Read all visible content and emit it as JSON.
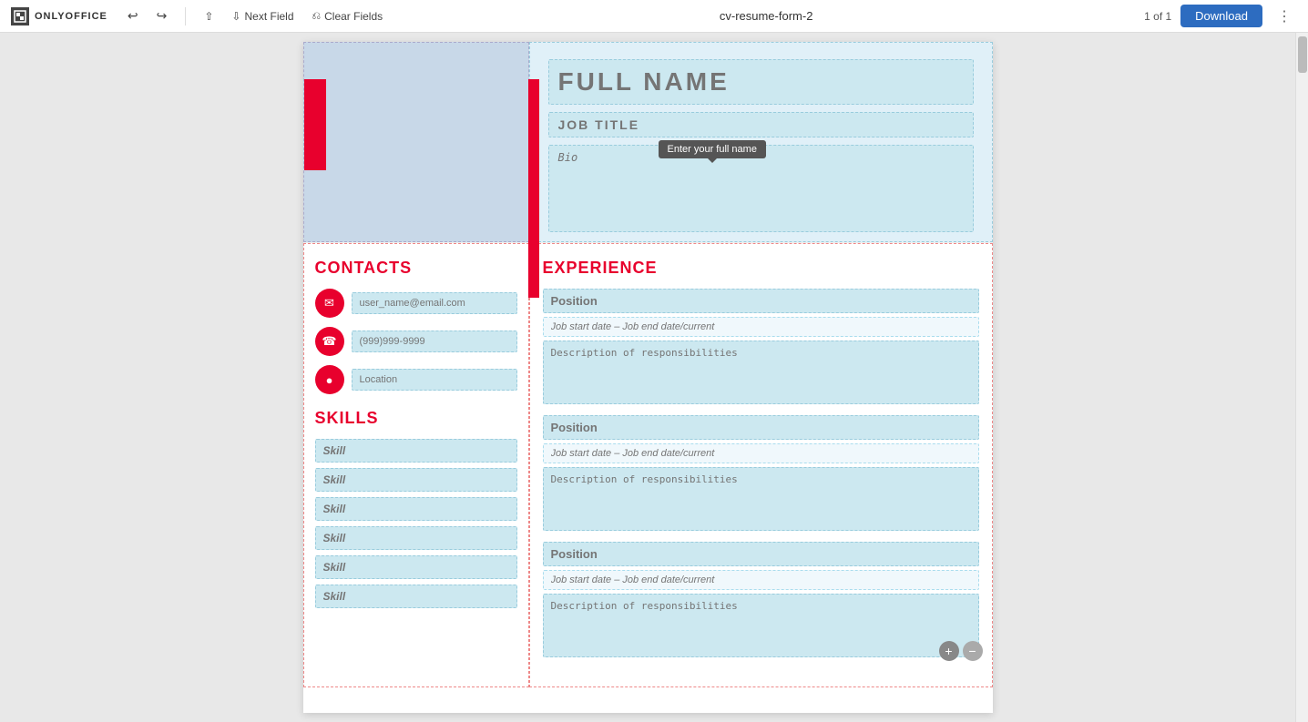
{
  "toolbar": {
    "logo_text": "ONLYOFFICE",
    "undo_label": "↩",
    "redo_label": "↪",
    "next_field_label": "Next Field",
    "clear_fields_label": "Clear Fields",
    "document_name": "cv-resume-form-2",
    "page_count": "1 of 1",
    "download_label": "Download",
    "more_label": "⋮"
  },
  "tooltip": {
    "text": "Enter your full name"
  },
  "resume": {
    "full_name_placeholder": "FULL NAME",
    "job_title_placeholder": "JOB TITLE",
    "bio_placeholder": "Bio",
    "contacts_title": "CONTACTS",
    "email_placeholder": "user_name@email.com",
    "phone_placeholder": "(999)999-9999",
    "location_placeholder": "Location",
    "skills_title": "SKILLS",
    "skills": [
      "Skill",
      "Skill",
      "Skill",
      "Skill",
      "Skill",
      "Skill"
    ],
    "experience_title": "EXPERIENCE",
    "experience_entries": [
      {
        "position_placeholder": "Position",
        "dates_placeholder": "Job start date – Job end date/current",
        "desc_placeholder": "Description of responsibilities",
        "show_controls": false
      },
      {
        "position_placeholder": "Position",
        "dates_placeholder": "Job start date – Job end date/current",
        "desc_placeholder": "Description of responsibilities",
        "show_controls": false
      },
      {
        "position_placeholder": "Position",
        "dates_placeholder": "Job start date – Job end date/current",
        "desc_placeholder": "Description of responsibilities",
        "show_controls": true
      }
    ]
  }
}
